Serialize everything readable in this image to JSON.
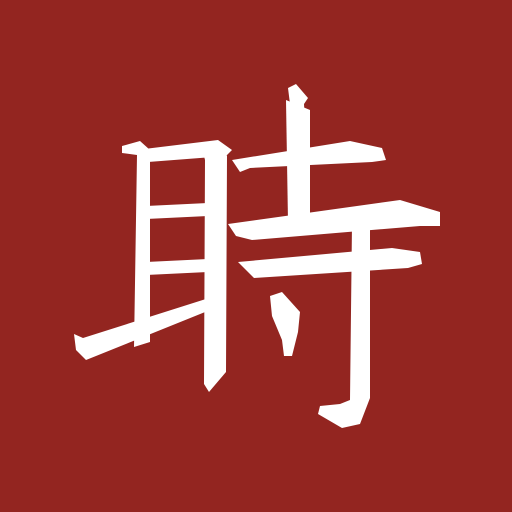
{
  "icon": {
    "character": "時",
    "background_color": "#932520",
    "glyph_color": "#ffffff"
  }
}
